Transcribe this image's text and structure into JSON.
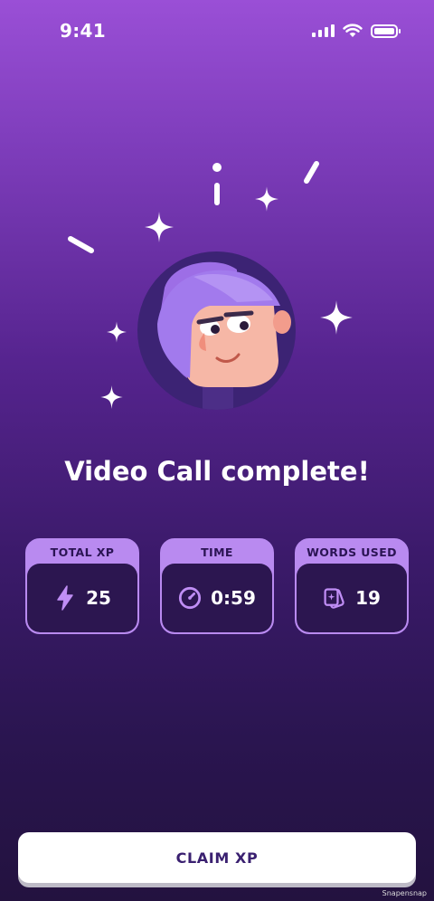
{
  "status_bar": {
    "time": "9:41"
  },
  "title": "Video Call complete!",
  "stats": [
    {
      "label": "TOTAL XP",
      "value": "25",
      "icon": "lightning-icon"
    },
    {
      "label": "TIME",
      "value": "0:59",
      "icon": "stopwatch-icon"
    },
    {
      "label": "WORDS USED",
      "value": "19",
      "icon": "cards-icon"
    }
  ],
  "claim_button": {
    "label": "CLAIM XP"
  },
  "watermark": "Snapensnap",
  "colors": {
    "accent": "#b98af0",
    "card_body": "#2c1650",
    "button_text": "#3a2070"
  }
}
